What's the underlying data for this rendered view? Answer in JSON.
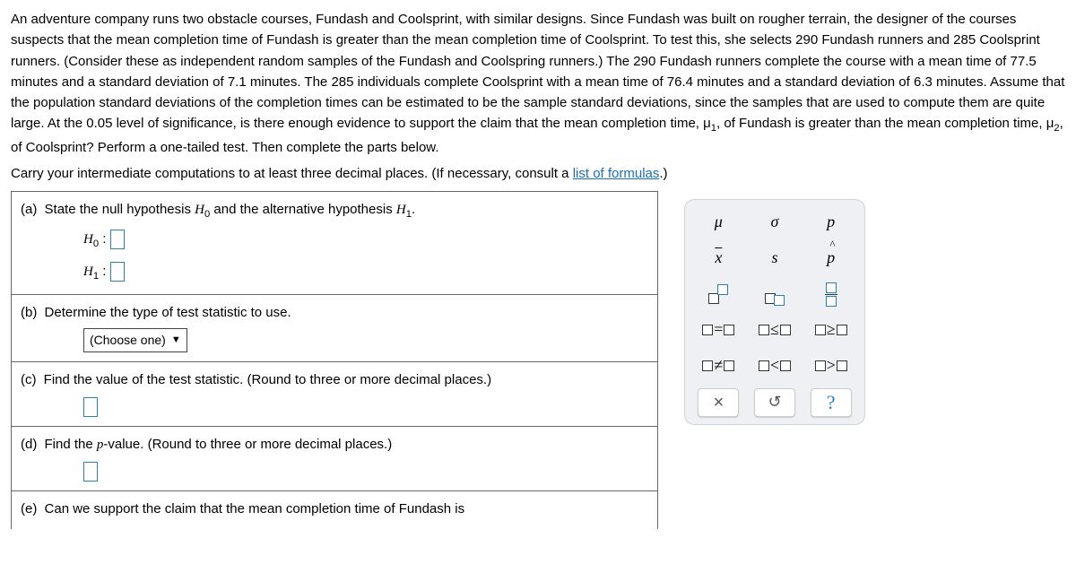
{
  "problem": {
    "p1": "An adventure company runs two obstacle courses, Fundash and Coolsprint, with similar designs. Since Fundash was built on rougher terrain, the designer of the courses suspects that the mean completion time of Fundash is greater than the mean completion time of Coolsprint. To test this, she selects 290 Fundash runners and 285 Coolsprint runners. (Consider these as independent random samples of the Fundash and Coolspring runners.) The 290 Fundash runners complete the course with a mean time of 77.5 minutes and a standard deviation of 7.1 minutes. The 285 individuals complete Coolsprint with a mean time of 76.4 minutes and a standard deviation of 6.3 minutes. Assume that the population standard deviations of the completion times can be estimated to be the sample standard deviations, since the samples that are used to compute them are quite large. At the 0.05 level of significance, is there enough evidence to support the claim that the mean completion time, μ",
    "p1_sub1": "1",
    "p1_mid": ", of Fundash is greater than the mean completion time, μ",
    "p1_sub2": "2",
    "p1_end": ", of Coolsprint? Perform a one-tailed test. Then complete the parts below.",
    "p2_pre": "Carry your intermediate computations to at least three decimal places. (If necessary, consult a ",
    "p2_link": "list of formulas",
    "p2_post": ".)"
  },
  "parts": {
    "a": {
      "letter": "(a)",
      "text_pre": "State the null hypothesis ",
      "H0": "H",
      "H0sub": "0",
      "text_mid": " and the alternative hypothesis ",
      "H1": "H",
      "H1sub": "1",
      "text_post": "."
    },
    "a_inputs": {
      "H0label": "H",
      "H0sub": "0",
      "colon": " : ",
      "H1label": "H",
      "H1sub": "1"
    },
    "b": {
      "letter": "(b)",
      "text": "Determine the type of test statistic to use.",
      "dropdown": "(Choose one)"
    },
    "c": {
      "letter": "(c)",
      "text": "Find the value of the test statistic. (Round to three or more decimal places.)"
    },
    "d": {
      "letter": "(d)",
      "text_pre": "Find the ",
      "pval": "p",
      "text_post": "-value. (Round to three or more decimal places.)"
    },
    "e": {
      "letter": "(e)",
      "text": "Can we support the claim that the mean completion time of Fundash is"
    }
  },
  "symbols": {
    "mu": "μ",
    "sigma": "σ",
    "p": "p",
    "xbar": "x",
    "s": "s",
    "phat": "p",
    "eq": "=",
    "le": "≤",
    "ge": "≥",
    "ne": "≠",
    "lt": "<",
    "gt": ">",
    "close": "×",
    "undo": "↺",
    "help": "?"
  }
}
